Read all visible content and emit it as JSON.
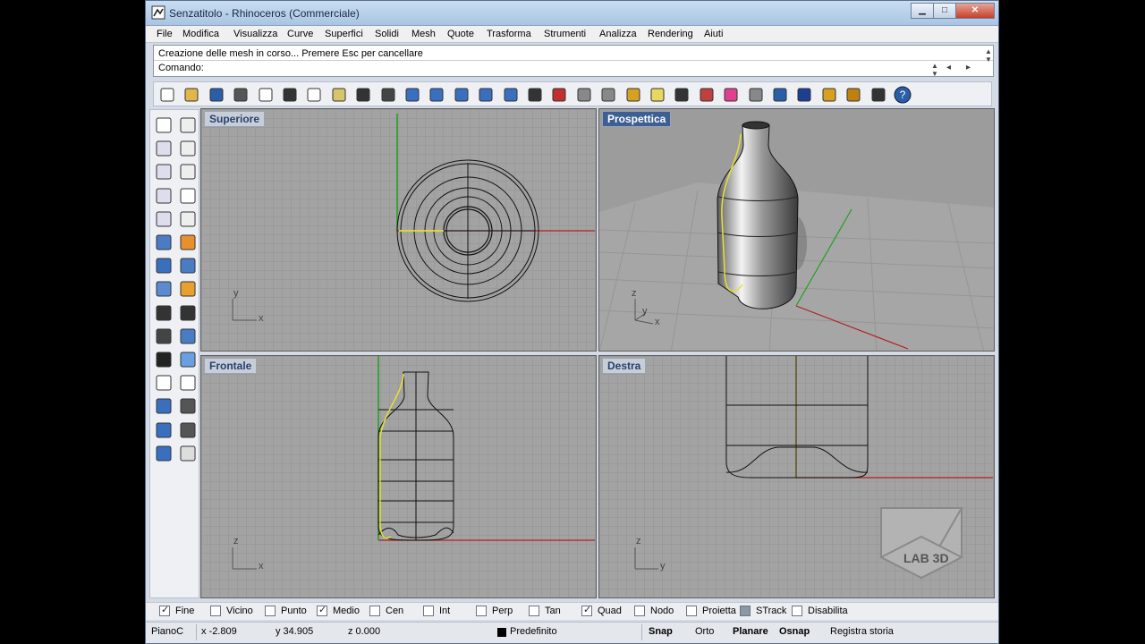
{
  "window": {
    "title": "Senzatitolo - Rhinoceros (Commerciale)",
    "min": "▁",
    "max": "□",
    "close": "✕"
  },
  "menu": [
    "File",
    "Modifica",
    "Visualizza",
    "Curve",
    "Superfici",
    "Solidi",
    "Mesh",
    "Quote",
    "Trasforma",
    "Strumenti",
    "Analizza",
    "Rendering",
    "Aiuti"
  ],
  "command": {
    "history": "Creazione delle mesh in corso... Premere Esc per cancellare",
    "prompt": "Comando:"
  },
  "viewports": {
    "top": "Superiore",
    "perspective": "Prospettica",
    "front": "Frontale",
    "right": "Destra"
  },
  "axes": {
    "x": "x",
    "y": "y",
    "z": "z"
  },
  "watermark": "LAB 3D",
  "osnaps": [
    {
      "label": "Fine",
      "checked": true
    },
    {
      "label": "Vicino",
      "checked": false
    },
    {
      "label": "Punto",
      "checked": false
    },
    {
      "label": "Medio",
      "checked": true
    },
    {
      "label": "Cen",
      "checked": false
    },
    {
      "label": "Int",
      "checked": false
    },
    {
      "label": "Perp",
      "checked": false
    },
    {
      "label": "Tan",
      "checked": false
    },
    {
      "label": "Quad",
      "checked": true
    },
    {
      "label": "Nodo",
      "checked": false
    },
    {
      "label": "Proietta",
      "checked": false
    },
    {
      "label": "STrack",
      "checked": true
    },
    {
      "label": "Disabilita",
      "checked": false
    }
  ],
  "status": {
    "plane": "PianoC",
    "x": "x -2.809",
    "y": "y 34.905",
    "z": "z 0.000",
    "layer": "Predefinito",
    "snap": "Snap",
    "ortho": "Orto",
    "planar": "Planare",
    "osnap": "Osnap",
    "history": "Registra storia"
  },
  "colors": {
    "grid": "#a3a3a3",
    "x_axis": "#b02020",
    "y_axis": "#20a020",
    "curve_yellow": "#e8e030",
    "active_tab": "#3d5f94"
  },
  "toolbar_icons": [
    "new-icon",
    "open-icon",
    "save-icon",
    "print-icon",
    "import-icon",
    "cut-icon",
    "copy-icon",
    "paste-icon",
    "undo-icon",
    "pan-hand-icon",
    "rotate-view-icon",
    "zoom-icon",
    "zoom-window-icon",
    "zoom-extents-icon",
    "zoom-selected-icon",
    "four-viewports-icon",
    "car-render-icon",
    "wireframe-icon",
    "shade-icon",
    "osnap-icon",
    "light-icon",
    "lock-icon",
    "layer-icon",
    "color-icon",
    "sphere-icon",
    "globe-icon",
    "render-icon",
    "select-icon",
    "gears-icon",
    "options-icon",
    "help-icon"
  ],
  "sidebar_icons": [
    "select-arrow-icon",
    "point-icon",
    "polyline-icon",
    "curve-icon",
    "circle-icon",
    "ellipse-icon",
    "polygon-icon",
    "rectangle-icon",
    "hexagon-icon",
    "fillet-curve-icon",
    "surface-icon",
    "patch-icon",
    "box-icon",
    "sphere-solid-icon",
    "cylinder-icon",
    "extrude-icon",
    "boolean-icon",
    "split-icon",
    "trim-icon",
    "join-icon",
    "explode-icon",
    "group-icon",
    "arc-icon",
    "offset-icon",
    "text-icon",
    "dimension-icon",
    "array-icon",
    "mirror-icon",
    "solid-tools-icon",
    "more-tools-icon"
  ]
}
